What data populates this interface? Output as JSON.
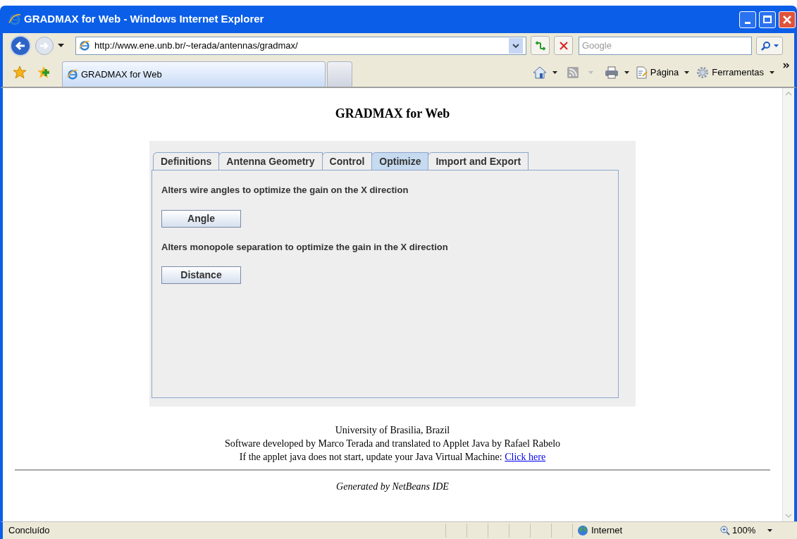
{
  "window": {
    "title": "GRADMAX for Web - Windows Internet Explorer"
  },
  "address_bar": {
    "url": "http://www.ene.unb.br/~terada/antennas/gradmax/"
  },
  "search": {
    "placeholder": "Google"
  },
  "browser_tabs": [
    {
      "label": "GRADMAX for Web",
      "selected": true
    },
    {
      "selected": false
    }
  ],
  "command_bar": [
    {
      "label": "Página"
    },
    {
      "label": "Ferramentas"
    }
  ],
  "page": {
    "heading": "GRADMAX for Web",
    "applet_tabs": [
      {
        "label": "Definitions",
        "selected": false
      },
      {
        "label": "Antenna Geometry",
        "selected": false
      },
      {
        "label": "Control",
        "selected": false
      },
      {
        "label": "Optimize",
        "selected": true
      },
      {
        "label": "Import and Export",
        "selected": false
      }
    ],
    "sections": [
      {
        "description": "Alters wire angles to optimize the gain on the X direction",
        "button": "Angle"
      },
      {
        "description": "Alters monopole separation to optimize the gain in the X direction",
        "button": "Distance"
      }
    ],
    "footer_lines": [
      "University of Brasilia, Brazil",
      "Software developed by Marco Terada and translated to Applet Java by Rafael Rabelo"
    ],
    "java_note": "If the applet java does not start, update your Java Virtual Machine:",
    "java_link": "Click here",
    "generated_by": "Generated by NetBeans IDE"
  },
  "status_bar": {
    "status": "Concluído",
    "zone": "Internet",
    "zoom": "100%"
  }
}
